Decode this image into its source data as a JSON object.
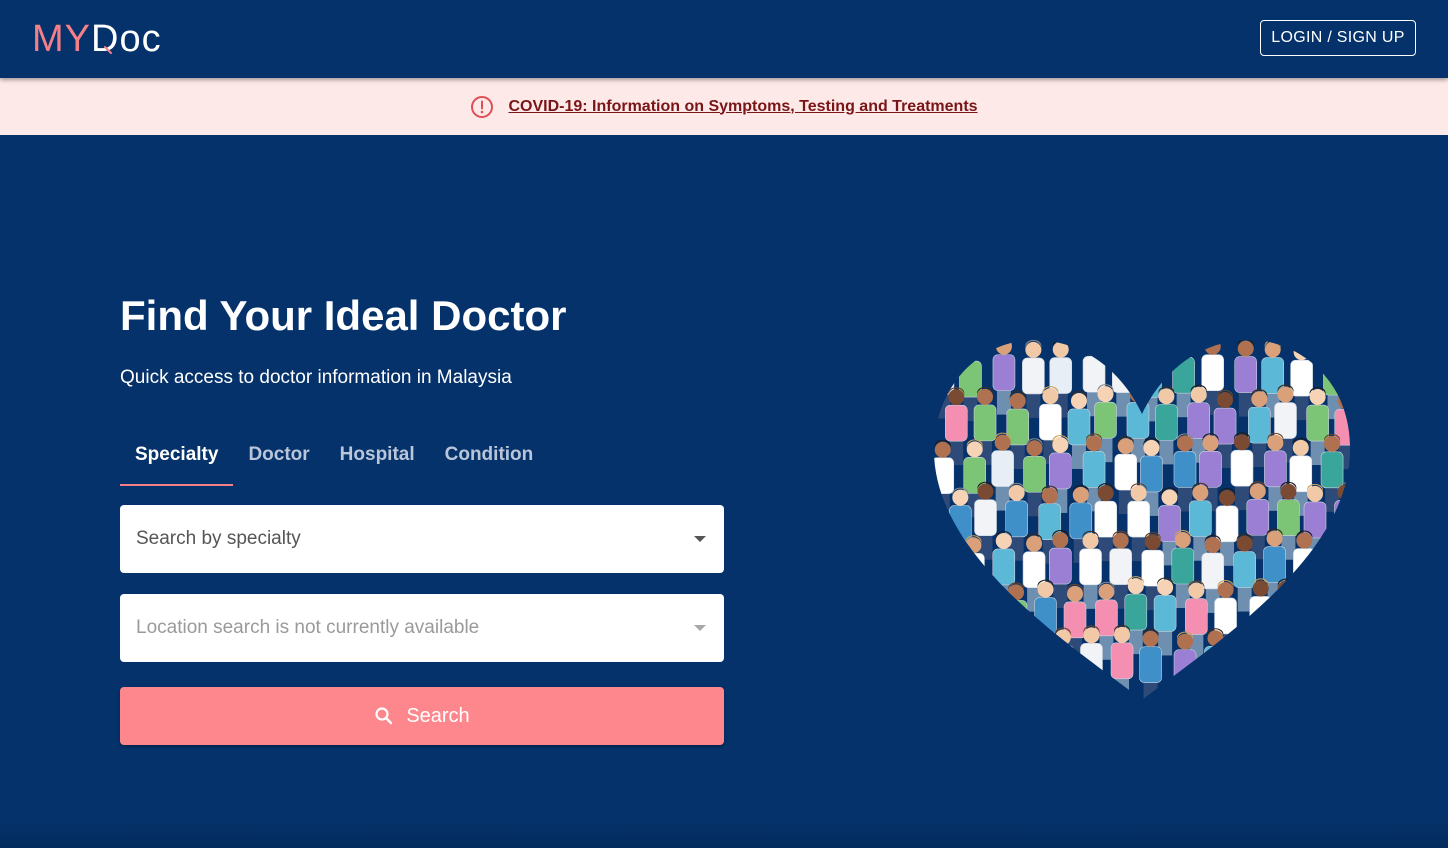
{
  "header": {
    "logo_my": "MY",
    "logo_doc": "Doc",
    "login_label": "LOGIN / SIGN UP"
  },
  "banner": {
    "icon": "alert-circle-icon",
    "link_text": "COVID-19: Information on Symptoms, Testing and Treatments"
  },
  "hero": {
    "title": "Find Your Ideal Doctor",
    "subtitle": "Quick access to doctor information in Malaysia",
    "tabs": [
      {
        "label": "Specialty",
        "active": true
      },
      {
        "label": "Doctor",
        "active": false
      },
      {
        "label": "Hospital",
        "active": false
      },
      {
        "label": "Condition",
        "active": false
      }
    ],
    "specialty_placeholder": "Search by specialty",
    "location_placeholder": "Location search is not currently available",
    "search_label": "Search",
    "search_icon": "search-icon",
    "illustration": "doctors-heart-illustration"
  },
  "colors": {
    "navy": "#05326a",
    "accent_pink": "#f47f88",
    "button_salmon": "#fd878c",
    "banner_bg": "#fde9e8",
    "banner_text": "#7a1517"
  }
}
